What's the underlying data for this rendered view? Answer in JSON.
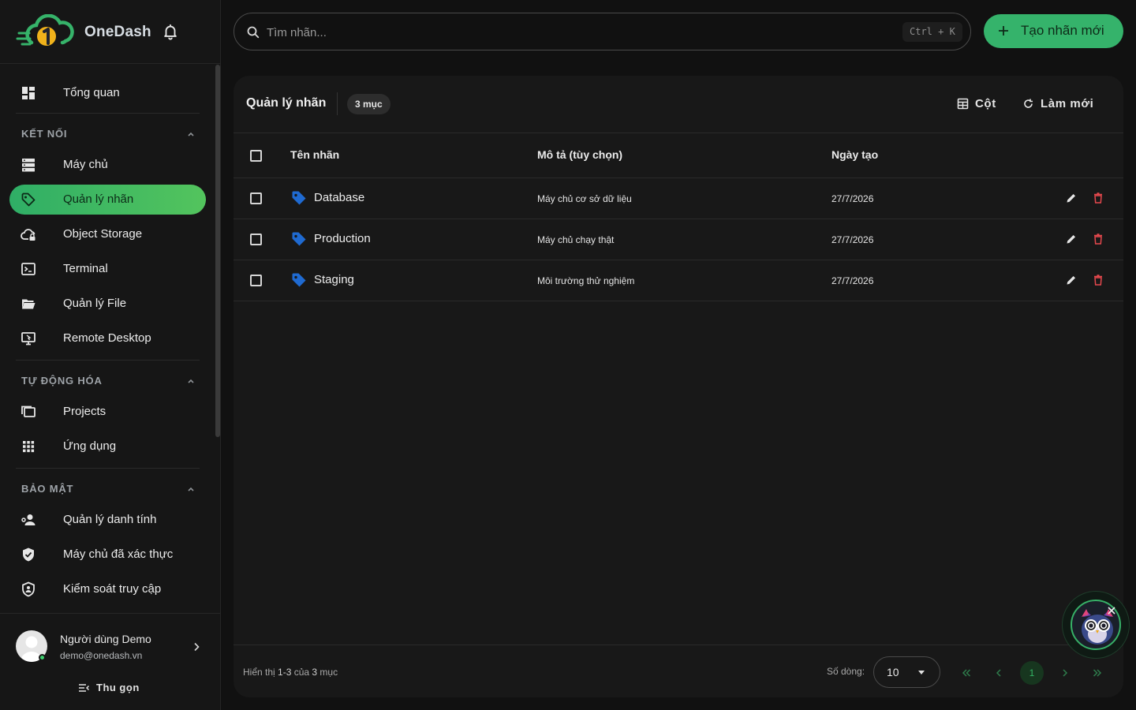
{
  "app": {
    "name": "OneDash"
  },
  "sidebar": {
    "overview": {
      "label": "Tổng quan",
      "icon": "dashboard-icon"
    },
    "sections": [
      {
        "title": "KẾT NỐI",
        "items": [
          {
            "label": "Máy chủ",
            "icon": "server-icon"
          },
          {
            "label": "Quản lý nhãn",
            "icon": "tag-icon",
            "active": true
          },
          {
            "label": "Object Storage",
            "icon": "cloud-lock-icon"
          },
          {
            "label": "Terminal",
            "icon": "terminal-icon"
          },
          {
            "label": "Quản lý File",
            "icon": "folder-open-icon"
          },
          {
            "label": "Remote Desktop",
            "icon": "remote-desktop-icon"
          }
        ]
      },
      {
        "title": "TỰ ĐỘNG HÓA",
        "items": [
          {
            "label": "Projects",
            "icon": "projects-icon"
          },
          {
            "label": "Ứng dụng",
            "icon": "apps-grid-icon"
          }
        ]
      },
      {
        "title": "BẢO MẬT",
        "items": [
          {
            "label": "Quản lý danh tính",
            "icon": "identity-icon"
          },
          {
            "label": "Máy chủ đã xác thực",
            "icon": "shield-check-icon"
          },
          {
            "label": "Kiểm soát truy cập",
            "icon": "access-control-icon"
          }
        ]
      }
    ],
    "user": {
      "name": "Người dùng Demo",
      "email": "demo@onedash.vn",
      "status": "online"
    },
    "collapse_label": "Thu gọn"
  },
  "topbar": {
    "search": {
      "placeholder": "Tìm nhãn...",
      "value": "",
      "shortcut": "Ctrl + K"
    },
    "create_label": "Tạo nhãn mới"
  },
  "panel": {
    "title": "Quản lý nhãn",
    "count_badge": "3 mục",
    "columns_label": "Cột",
    "refresh_label": "Làm mới",
    "table": {
      "headers": [
        "Tên nhãn",
        "Mô tả (tùy chọn)",
        "Ngày tạo"
      ],
      "rows": [
        {
          "name": "Database",
          "description": "Máy chủ cơ sở dữ liệu",
          "created": "27/7/2026",
          "tag_color": "#1f6ad1"
        },
        {
          "name": "Production",
          "description": "Máy chủ chạy thật",
          "created": "27/7/2026",
          "tag_color": "#1f6ad1"
        },
        {
          "name": "Staging",
          "description": "Môi trường thử nghiệm",
          "created": "27/7/2026",
          "tag_color": "#1f6ad1"
        }
      ]
    },
    "footer": {
      "info_prefix": "Hiển thị ",
      "info_range": "1-3",
      "info_mid": " của ",
      "info_total": "3",
      "info_suffix": " mục",
      "rows_label": "Số dòng:",
      "rows_per_page": "10",
      "current_page": "1"
    }
  },
  "colors": {
    "accent": "#35b36b",
    "danger": "#e5484d",
    "tag": "#1f6ad1",
    "background": "#111111"
  }
}
